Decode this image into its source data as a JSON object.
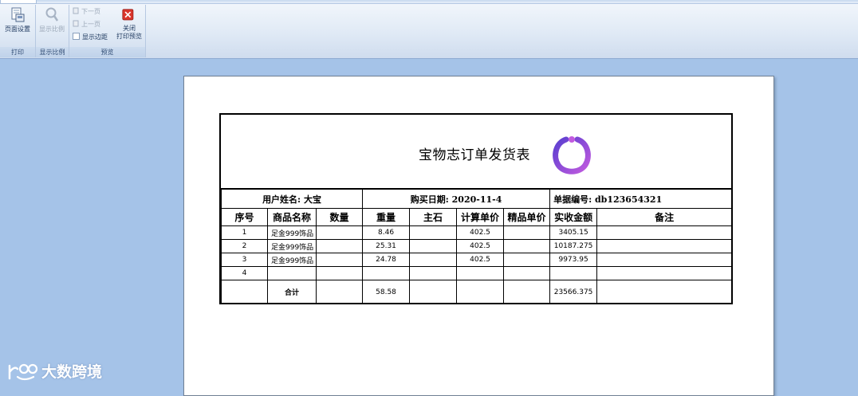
{
  "ribbon": {
    "groups": [
      {
        "label": "打印"
      },
      {
        "label": "显示比例"
      },
      {
        "label": "预览"
      }
    ],
    "page_setup_label": "页面设置",
    "zoom_label": "显示比例",
    "next_page_label": "下一页",
    "prev_page_label": "上一页",
    "show_margins_label": "显示边距",
    "close_label_line1": "关闭",
    "close_label_line2": "打印预览"
  },
  "report": {
    "title": "宝物志订单发货表",
    "customer": "用户姓名: 大宝",
    "purchase_date": "购买日期: 2020-11-4",
    "order_number": "单据编号: db123654321",
    "columns": [
      "序号",
      "商品名称",
      "数量",
      "重量",
      "主石",
      "计算单价",
      "精品单价",
      "实收金额",
      "备注"
    ],
    "rows": [
      {
        "seq": "1",
        "name": "足金999饰品",
        "qty": "",
        "weight": "8.46",
        "stone": "",
        "unit_price": "402.5",
        "premium_price": "",
        "amount": "3405.15",
        "remark": ""
      },
      {
        "seq": "2",
        "name": "足金999饰品",
        "qty": "",
        "weight": "25.31",
        "stone": "",
        "unit_price": "402.5",
        "premium_price": "",
        "amount": "10187.275",
        "remark": ""
      },
      {
        "seq": "3",
        "name": "足金999饰品",
        "qty": "",
        "weight": "24.78",
        "stone": "",
        "unit_price": "402.5",
        "premium_price": "",
        "amount": "9973.95",
        "remark": ""
      },
      {
        "seq": "4",
        "name": "",
        "qty": "",
        "weight": "",
        "stone": "",
        "unit_price": "",
        "premium_price": "",
        "amount": "",
        "remark": ""
      }
    ],
    "total_label": "合计",
    "total_weight": "58.58",
    "total_amount": "23566.375"
  },
  "watermark": "大数跨境",
  "colors": {
    "workspace": "#a5c3e8",
    "logo_gradient_start": "#5b3fd0",
    "logo_gradient_end": "#c15adf",
    "close_icon": "#d9342b"
  }
}
